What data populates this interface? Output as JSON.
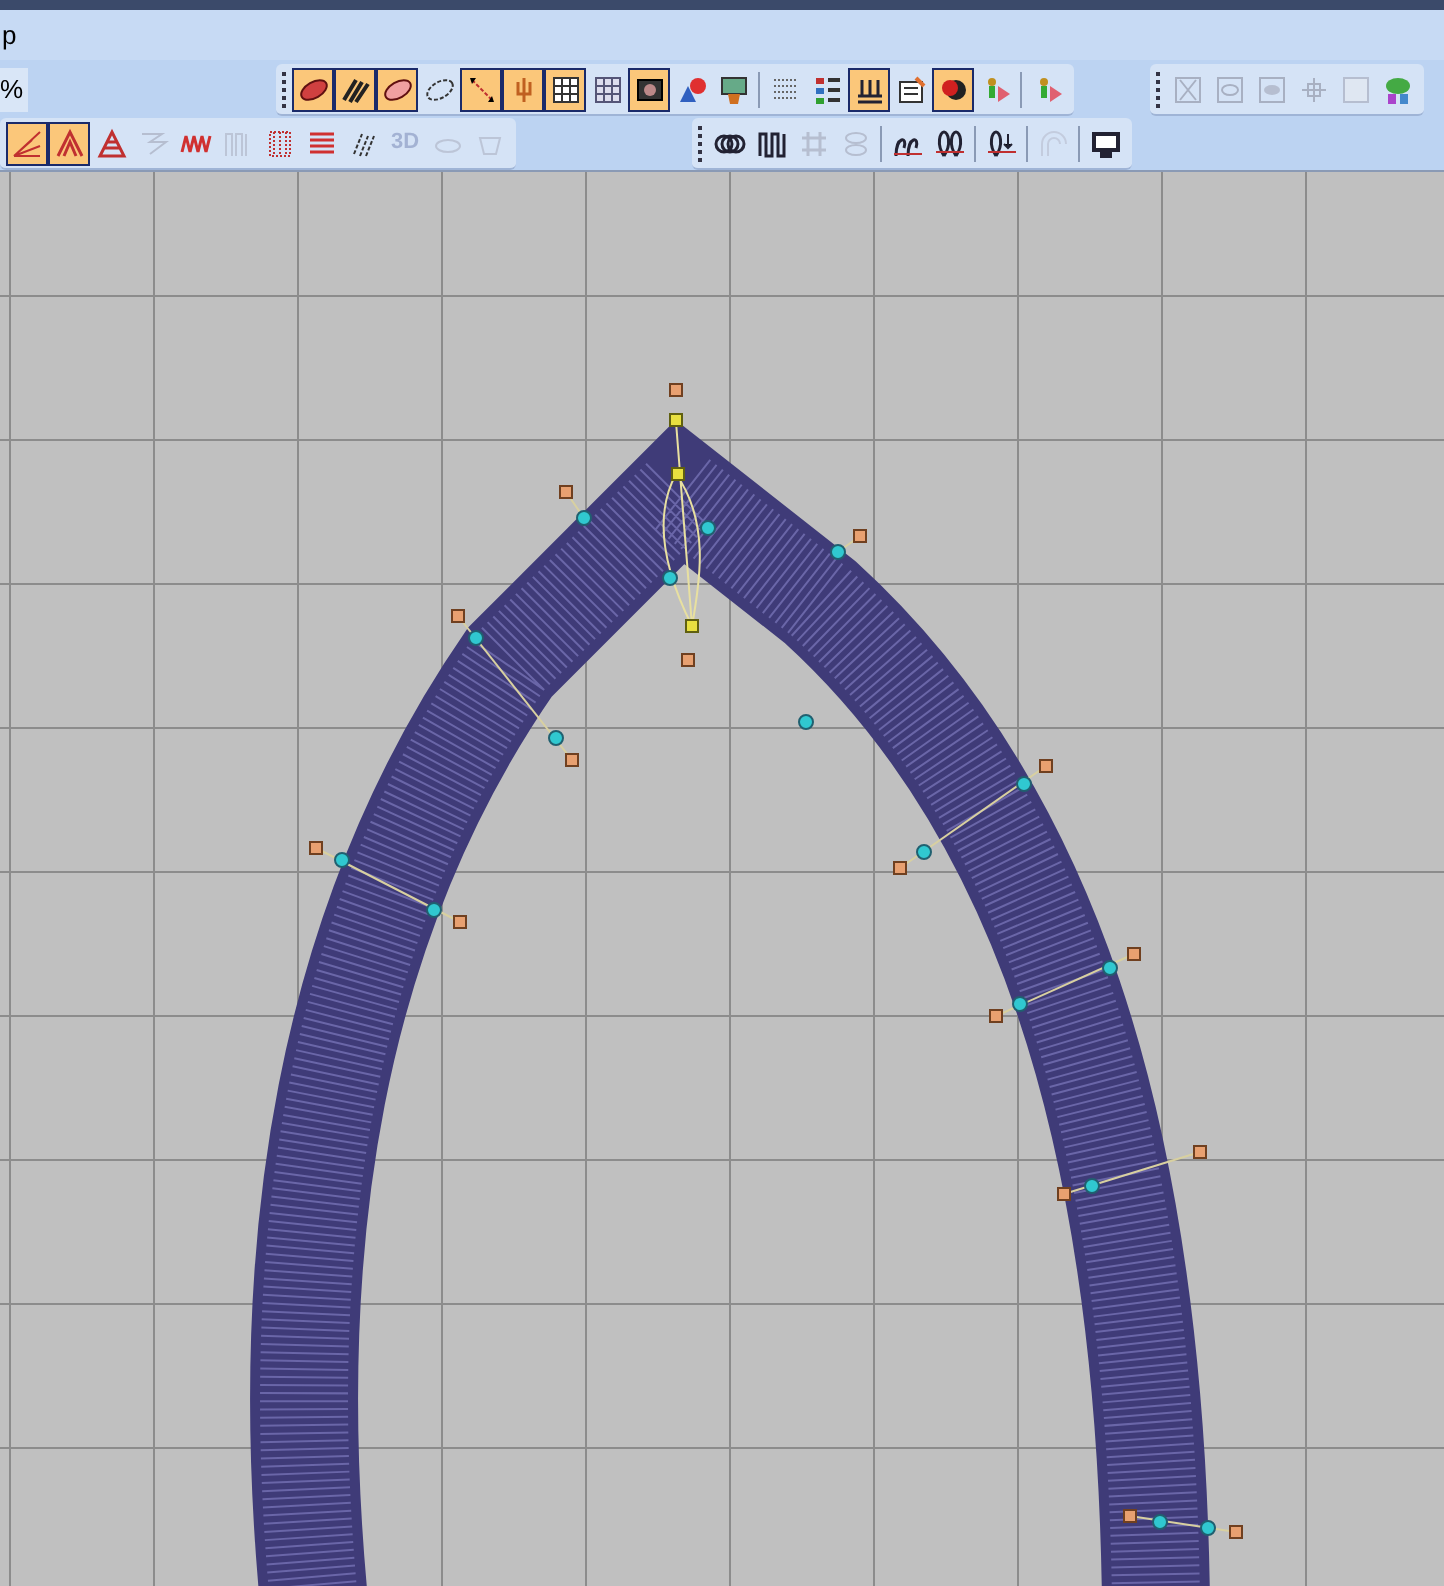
{
  "menu_bar": {
    "items": [
      {
        "label": "p"
      }
    ]
  },
  "zoom_field": {
    "value": "%"
  },
  "toolbars": [
    {
      "buttons": [
        {
          "selected": true,
          "disabled": false
        },
        {
          "selected": true,
          "disabled": false
        },
        {
          "selected": true,
          "disabled": false
        },
        {
          "selected": false,
          "disabled": false
        },
        {
          "selected": true,
          "disabled": false
        },
        {
          "selected": true,
          "disabled": false
        },
        {
          "selected": true,
          "disabled": false
        },
        {
          "selected": false,
          "disabled": false
        },
        {
          "selected": true,
          "disabled": false
        },
        {
          "selected": false,
          "disabled": false
        },
        {
          "selected": false,
          "disabled": false
        },
        {
          "kind": "separator"
        },
        {
          "selected": false,
          "disabled": false
        },
        {
          "selected": false,
          "disabled": false
        },
        {
          "selected": true,
          "disabled": false
        },
        {
          "selected": false,
          "disabled": false
        },
        {
          "selected": true,
          "disabled": false
        },
        {
          "selected": false,
          "disabled": false
        },
        {
          "kind": "separator"
        },
        {
          "selected": false,
          "disabled": false
        }
      ]
    },
    {
      "buttons": [
        {
          "selected": false,
          "disabled": true
        },
        {
          "selected": false,
          "disabled": true
        },
        {
          "selected": false,
          "disabled": true
        },
        {
          "selected": false,
          "disabled": true
        },
        {
          "selected": false,
          "disabled": true
        },
        {
          "selected": false,
          "disabled": false
        }
      ]
    },
    {
      "buttons": [
        {
          "selected": true,
          "disabled": false
        },
        {
          "selected": true,
          "disabled": false
        },
        {
          "selected": false,
          "disabled": false
        },
        {
          "selected": false,
          "disabled": true
        },
        {
          "selected": false,
          "disabled": false
        },
        {
          "selected": false,
          "disabled": true
        },
        {
          "selected": false,
          "disabled": false
        },
        {
          "selected": false,
          "disabled": false
        },
        {
          "selected": false,
          "disabled": false
        },
        {
          "selected": false,
          "disabled": true,
          "label": "3D"
        },
        {
          "selected": false,
          "disabled": true
        },
        {
          "selected": false,
          "disabled": true
        }
      ]
    },
    {
      "buttons": [
        {
          "selected": false,
          "disabled": false
        },
        {
          "selected": false,
          "disabled": false
        },
        {
          "selected": false,
          "disabled": true
        },
        {
          "selected": false,
          "disabled": true
        },
        {
          "kind": "separator"
        },
        {
          "selected": false,
          "disabled": false
        },
        {
          "selected": false,
          "disabled": false
        },
        {
          "kind": "separator"
        },
        {
          "selected": false,
          "disabled": false
        },
        {
          "kind": "separator"
        },
        {
          "selected": false,
          "disabled": true
        },
        {
          "kind": "separator"
        },
        {
          "selected": false,
          "disabled": false
        }
      ]
    }
  ]
}
